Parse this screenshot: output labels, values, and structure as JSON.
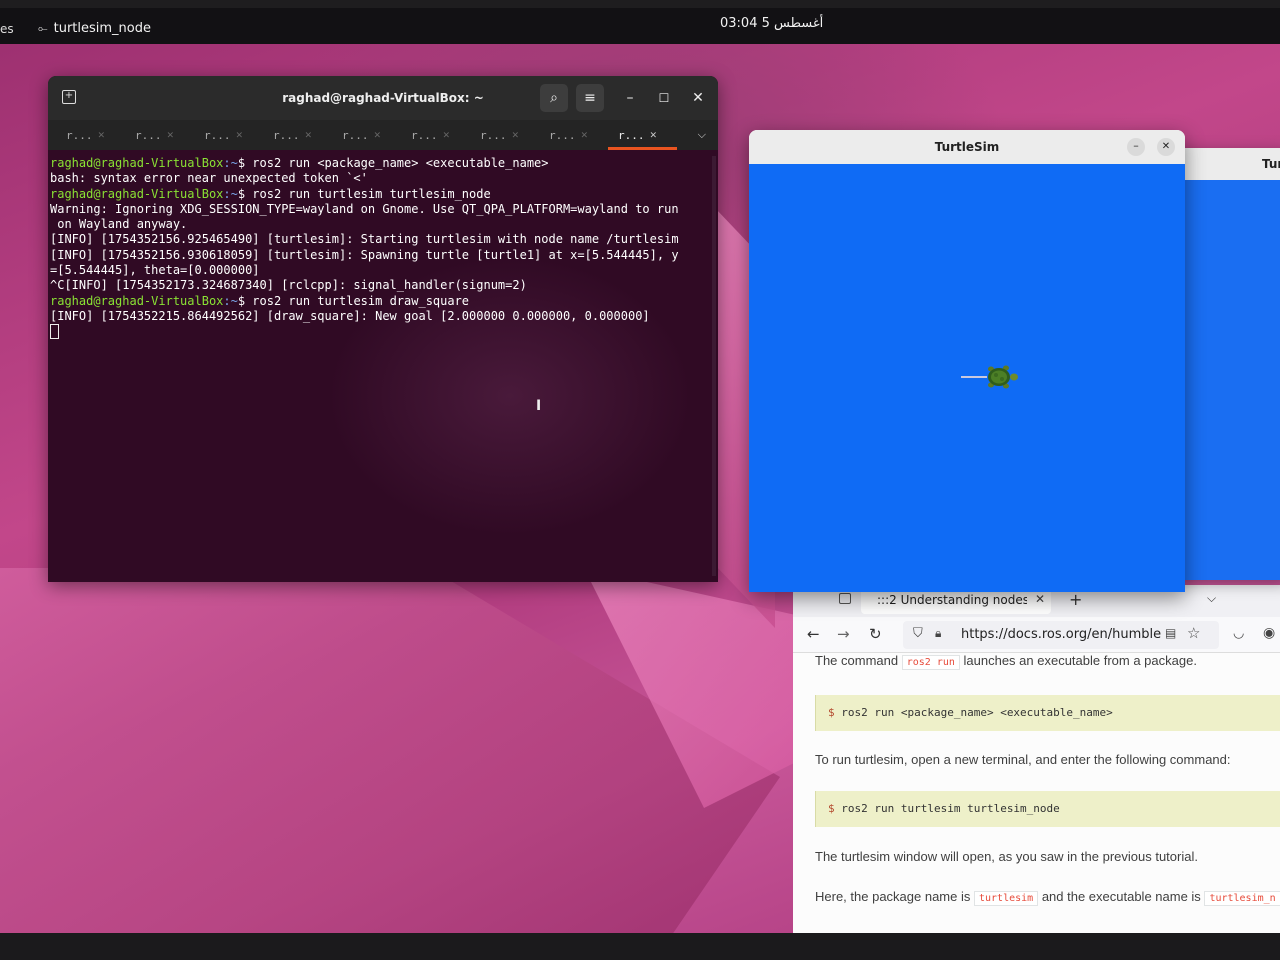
{
  "topbar": {
    "activities": "es",
    "app_name": "turtlesim_node",
    "clock": "03:04  5 أغسطس"
  },
  "terminal": {
    "title": "raghad@raghad-VirtualBox: ~",
    "tabs": [
      {
        "label": "r..."
      },
      {
        "label": "r..."
      },
      {
        "label": "r..."
      },
      {
        "label": "r..."
      },
      {
        "label": "r..."
      },
      {
        "label": "r..."
      },
      {
        "label": "r..."
      },
      {
        "label": "r..."
      },
      {
        "label": "r..."
      }
    ],
    "prompt_user": "raghad@raghad-VirtualBox",
    "prompt_path": ":~",
    "prompt_suffix": "$ ",
    "cmd1": "ros2 run <package_name> <executable_name>",
    "out1": "bash: syntax error near unexpected token `<'",
    "cmd2": "ros2 run turtlesim turtlesim_node",
    "out2": "Warning: Ignoring XDG_SESSION_TYPE=wayland on Gnome. Use QT_QPA_PLATFORM=wayland to run",
    "out3": " on Wayland anyway.",
    "out4": "[INFO] [1754352156.925465490] [turtlesim]: Starting turtlesim with node name /turtlesim",
    "out5": "[INFO] [1754352156.930618059] [turtlesim]: Spawning turtle [turtle1] at x=[5.544445], y",
    "out6": "=[5.544445], theta=[0.000000]",
    "out7": "^C[INFO] [1754352173.324687340] [rclcpp]: signal_handler(signum=2)",
    "cmd3": "ros2 run turtlesim draw_square",
    "out8": "[INFO] [1754352215.864492562] [draw_square]: New goal [2.000000 0.000000, 0.000000]"
  },
  "turtlesim": {
    "title": "TurtleSim",
    "second_title": "Tur",
    "background_color": "#0f6bf5"
  },
  "firefox": {
    "tab_label": ":::2 Understanding nodes —",
    "url": "https://docs.ros.org/en/humble/",
    "para1_pre": "The command",
    "para1_code": "ros2 run",
    "para1_post": "launches an executable from a package.",
    "code1": "ros2 run <package_name> <executable_name>",
    "para2": "To run turtlesim, open a new terminal, and enter the following command:",
    "code2": "ros2 run turtlesim turtlesim_node",
    "para3_pre": "The turtlesim window will open, as you saw in the",
    "para3_link": "previous tutorial",
    "para3_post": ".",
    "para4_pre": "Here, the package name is",
    "para4_code1": "turtlesim",
    "para4_mid": "and the executable name is",
    "para4_code2": "turtlesim_n",
    "code_prompt": "$"
  },
  "colors": {
    "terminal_bg": "#300a24",
    "prompt_user": "#8ae234",
    "prompt_path": "#7aa4e8",
    "tab_accent": "#e95420"
  }
}
